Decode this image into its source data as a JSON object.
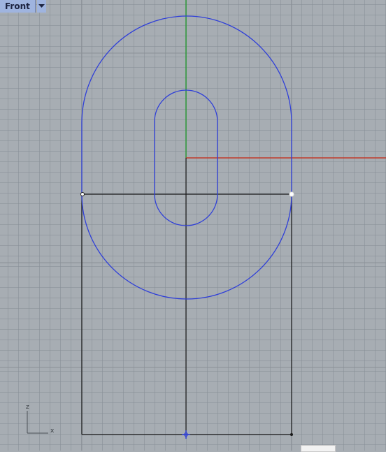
{
  "viewport": {
    "name": "Front",
    "menu_icon": "dropdown-arrow-icon"
  },
  "axes": {
    "vertical_label": "z",
    "horizontal_label": "x",
    "colors": {
      "x_axis": "#c0392b",
      "y_axis": "#2e9a3a",
      "curves": "#2f3fd8",
      "construction": "#1a1a1a",
      "grid_background": "#a7adb3"
    }
  },
  "corner_label": ""
}
